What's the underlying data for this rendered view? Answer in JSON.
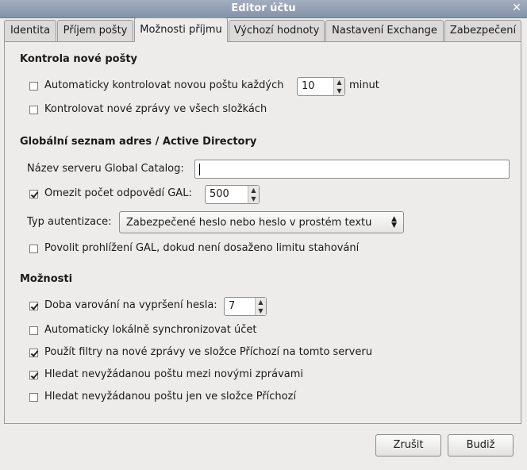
{
  "window": {
    "title": "Editor účtu"
  },
  "tabs": [
    {
      "label": "Identita"
    },
    {
      "label": "Příjem pošty"
    },
    {
      "label": "Možnosti příjmu"
    },
    {
      "label": "Výchozí hodnoty"
    },
    {
      "label": "Nastavení Exchange"
    },
    {
      "label": "Zabezpečení"
    }
  ],
  "check_mail": {
    "heading": "Kontrola nové pošty",
    "auto_check_label": "Automaticky kontrolovat novou poštu každých",
    "auto_check_checked": false,
    "interval_value": "10",
    "interval_unit": "minut",
    "all_folders_label": "Kontrolovat nové zprávy ve všech složkách",
    "all_folders_checked": false
  },
  "gal": {
    "heading": "Globální seznam adres / Active Directory",
    "server_label": "Název serveru Global Catalog:",
    "server_value": "",
    "limit_label": "Omezit počet odpovědí GAL:",
    "limit_checked": true,
    "limit_value": "500",
    "auth_label": "Typ autentizace:",
    "auth_value": "Zabezpečené heslo nebo heslo v prostém textu",
    "browse_label": "Povolit prohlížení GAL, dokud není dosaženo limitu stahování",
    "browse_checked": false
  },
  "options": {
    "heading": "Možnosti",
    "warn_label": "Doba varování na vypršení hesla:",
    "warn_checked": true,
    "warn_value": "7",
    "sync_label": "Automaticky lokálně synchronizovat účet",
    "sync_checked": false,
    "filters_label": "Použít filtry na nové zprávy ve složce Příchozí na tomto serveru",
    "filters_checked": true,
    "junk_label": "Hledat nevyžádanou poštu mezi novými zprávami",
    "junk_checked": true,
    "junk_inbox_label": "Hledat nevyžádanou poštu jen ve složce Příchozí",
    "junk_inbox_checked": false
  },
  "buttons": {
    "cancel": "Zrušit",
    "ok": "Budiž"
  }
}
